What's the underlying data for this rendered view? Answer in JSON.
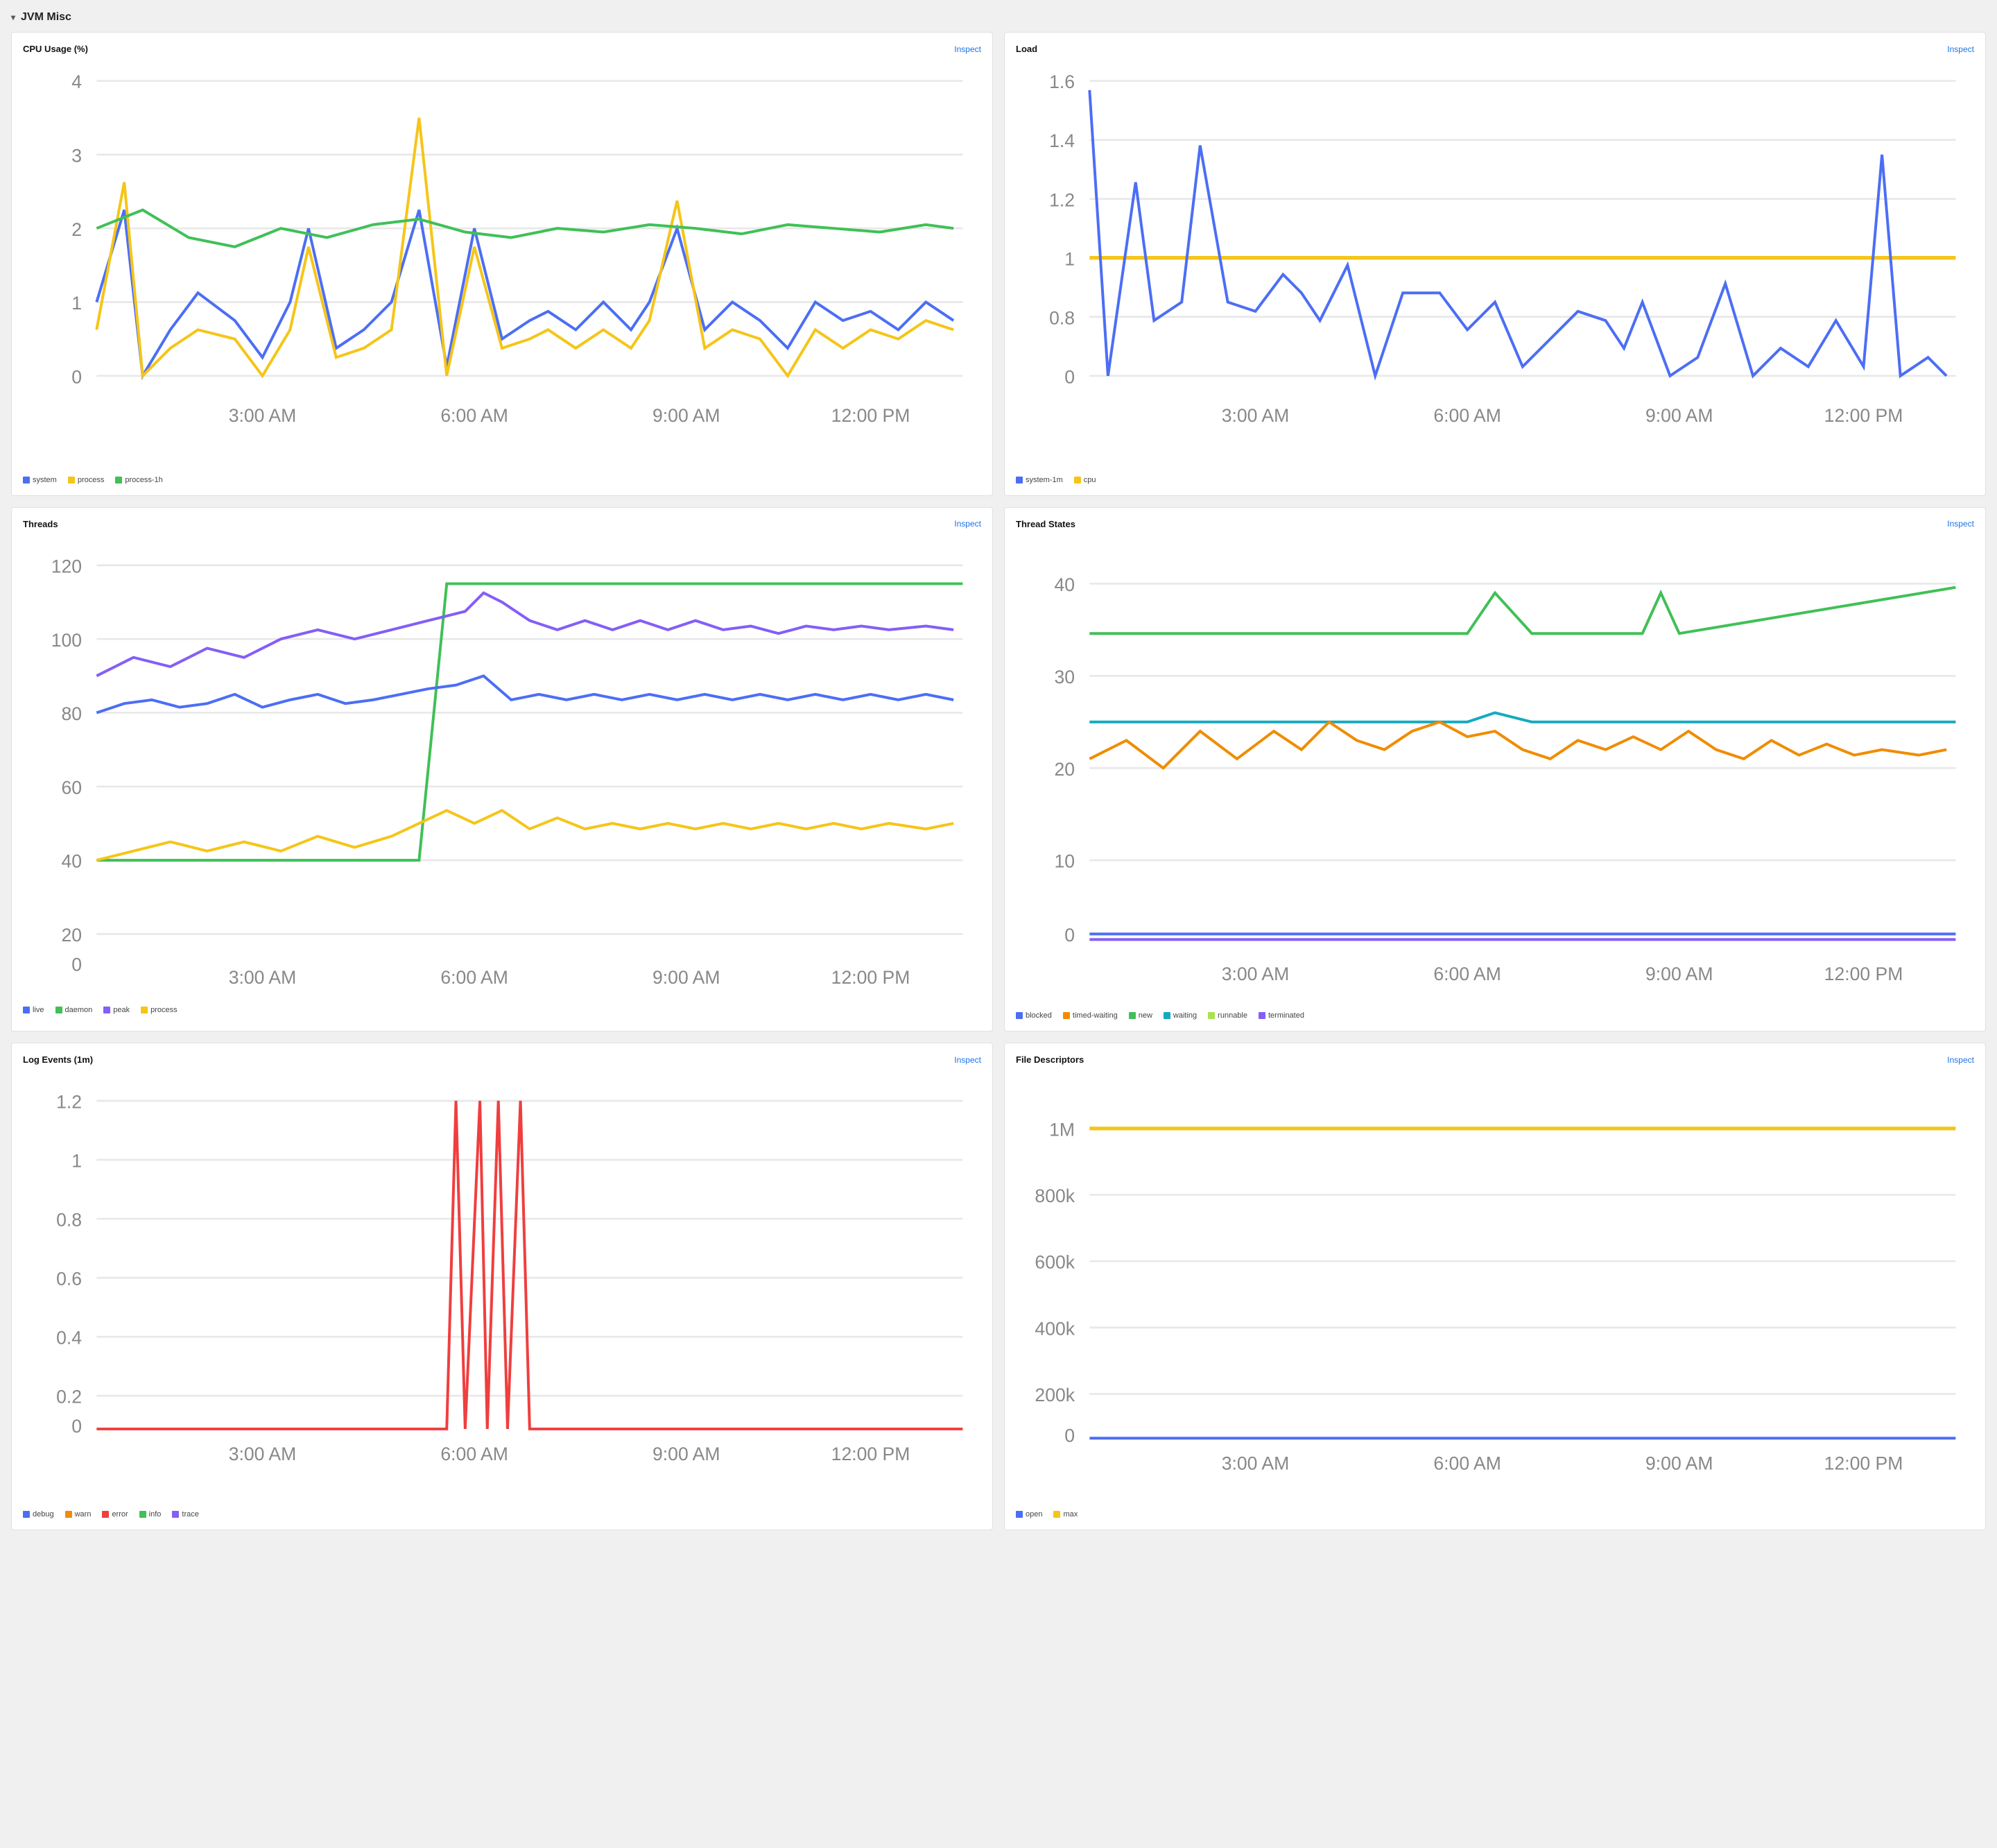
{
  "section": {
    "title": "JVM Misc"
  },
  "panels": {
    "cpu_usage": {
      "title": "CPU Usage (%)",
      "inspect_label": "Inspect",
      "legend": [
        {
          "label": "system",
          "color": "#4c6ef5"
        },
        {
          "label": "process",
          "color": "#f5c518"
        },
        {
          "label": "process-1h",
          "color": "#40c057"
        }
      ]
    },
    "load": {
      "title": "Load",
      "inspect_label": "Inspect",
      "legend": [
        {
          "label": "system-1m",
          "color": "#4c6ef5"
        },
        {
          "label": "cpu",
          "color": "#f5c518"
        }
      ]
    },
    "threads": {
      "title": "Threads",
      "inspect_label": "Inspect",
      "legend": [
        {
          "label": "live",
          "color": "#4c6ef5"
        },
        {
          "label": "daemon",
          "color": "#40c057"
        },
        {
          "label": "peak",
          "color": "#845ef7"
        },
        {
          "label": "process",
          "color": "#f5c518"
        }
      ]
    },
    "thread_states": {
      "title": "Thread States",
      "inspect_label": "Inspect",
      "legend": [
        {
          "label": "blocked",
          "color": "#4c6ef5"
        },
        {
          "label": "timed-waiting",
          "color": "#f08c00"
        },
        {
          "label": "new",
          "color": "#40c057"
        },
        {
          "label": "waiting",
          "color": "#15aabf"
        },
        {
          "label": "runnable",
          "color": "#a9e34b"
        },
        {
          "label": "terminated",
          "color": "#845ef7"
        }
      ]
    },
    "log_events": {
      "title": "Log Events (1m)",
      "inspect_label": "Inspect",
      "legend": [
        {
          "label": "debug",
          "color": "#4c6ef5"
        },
        {
          "label": "warn",
          "color": "#f08c00"
        },
        {
          "label": "error",
          "color": "#f03e3e"
        },
        {
          "label": "info",
          "color": "#40c057"
        },
        {
          "label": "trace",
          "color": "#845ef7"
        }
      ]
    },
    "file_descriptors": {
      "title": "File Descriptors",
      "inspect_label": "Inspect",
      "legend": [
        {
          "label": "open",
          "color": "#4c6ef5"
        },
        {
          "label": "max",
          "color": "#f5c518"
        }
      ]
    }
  },
  "time_labels": [
    "3:00 AM",
    "6:00 AM",
    "9:00 AM",
    "12:00 PM"
  ]
}
